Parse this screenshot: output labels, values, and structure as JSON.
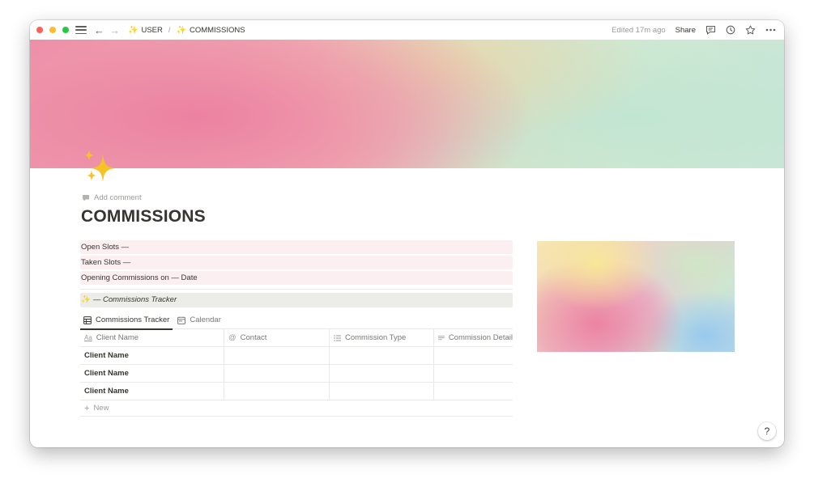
{
  "titlebar": {
    "breadcrumb": [
      {
        "label": "USER",
        "icon": "sparkles-icon"
      },
      {
        "label": "COMMISSIONS",
        "icon": "sparkles-icon"
      }
    ],
    "separator": "/",
    "edited": "Edited 17m ago",
    "share_label": "Share"
  },
  "page": {
    "add_comment": "Add comment",
    "title": "COMMISSIONS",
    "icon": "sparkles-icon"
  },
  "callouts": [
    "Open Slots —",
    "Taken Slots —",
    "Opening Commissions on — Date"
  ],
  "database": {
    "header": "— Commissions Tracker",
    "views": [
      {
        "label": "Commissions Tracker",
        "icon": "table-icon",
        "active": true
      },
      {
        "label": "Calendar",
        "icon": "calendar-icon",
        "active": false
      }
    ],
    "columns": [
      {
        "label": "Client Name",
        "icon": "title-icon"
      },
      {
        "label": "Contact",
        "icon": "at-icon"
      },
      {
        "label": "Commission Type",
        "icon": "list-icon"
      },
      {
        "label": "Commission Detail",
        "icon": "text-icon"
      }
    ],
    "rows": [
      {
        "name": "Client Name"
      },
      {
        "name": "Client Name"
      },
      {
        "name": "Client Name"
      }
    ],
    "new_label": "New"
  },
  "help_label": "?",
  "colors": {
    "callout_bg": "#fbeff2",
    "db_header_bg": "#ecece9",
    "text": "#37352f",
    "muted": "#9b9a97"
  }
}
